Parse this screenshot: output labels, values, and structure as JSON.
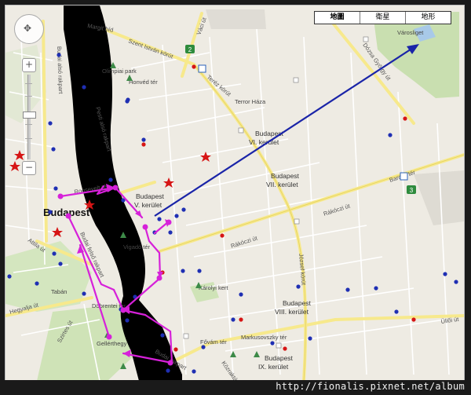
{
  "map_type_buttons": [
    "地圖",
    "衛星",
    "地形"
  ],
  "nav": {
    "pan_glyph": "✥",
    "zoom_in": "+",
    "zoom_out": "−"
  },
  "labels": {
    "city": "Budapest",
    "varosliget": "Városliget",
    "margit_hid": "Margit híd",
    "szent_istvan": "Szent István körút",
    "vaci_ut": "Váci út",
    "olimpiai": "Olimpiai park",
    "honved": "Honvéd tér",
    "terez": "Teréz körút",
    "terror": "Terror Háza",
    "dozsa": "Dózsa György út",
    "district6": [
      "Budapest",
      "VI. kerület"
    ],
    "district7": [
      "Budapest",
      "VII. kerület"
    ],
    "district5": [
      "Budapest",
      "V. kerület"
    ],
    "district8": [
      "Budapest",
      "VIII. kerület"
    ],
    "district9": [
      "Budapest",
      "IX. kerület"
    ],
    "roosevelt": "Roosevelt tér",
    "vigado": "Vigadó tér",
    "baross": "Baross tér",
    "rakoczi1": "Rákóczi út",
    "rakoczi2": "Rákóczi út",
    "karolyi": "Károlyi kert",
    "jozsef": "József körút",
    "attila": "Attila út",
    "taban": "Tabán",
    "hegyalja": "Hegyalja út",
    "dobrenter": "Döbrentei tér",
    "gellerthegy": "Gellérthegy",
    "fovam": "Fővám tér",
    "markusovszky": "Markusovszky tér",
    "ulloi": "Üllői út",
    "kozraktar": "Közraktár",
    "budai_also": "Budai alsó rakpart",
    "pesti_also": "Pesti alsó rakpart",
    "budai_felso": "Budai felső rakpart",
    "szirtes": "Szirtes út",
    "budai_rak2": "Budai rakpart"
  },
  "route_shields": [
    "2",
    "3"
  ],
  "url": "http://fionalis.pixnet.net/album"
}
